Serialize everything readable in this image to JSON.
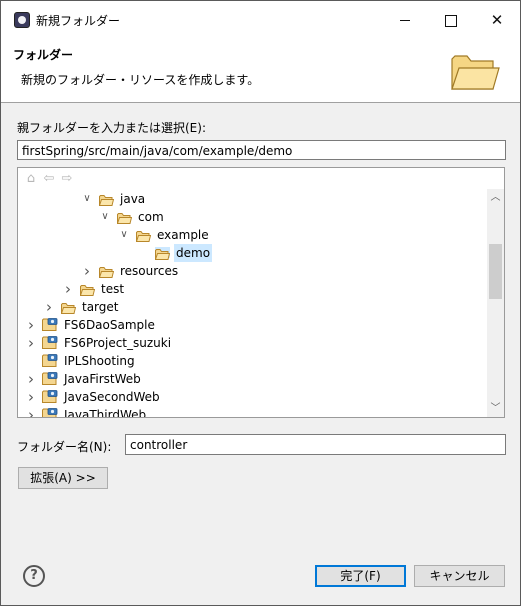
{
  "window": {
    "title": "新規フォルダー",
    "minimize": "minimize",
    "maximize": "maximize",
    "close": "✕"
  },
  "banner": {
    "title": "フォルダー",
    "description": "新規のフォルダー・リソースを作成します。",
    "icon": "folder-large-icon"
  },
  "parent": {
    "label": "親フォルダーを入力または選択(E):",
    "value": "firstSpring/src/main/java/com/example/demo"
  },
  "toolbar": {
    "home_icon": "home-icon",
    "back_icon": "back-arrow-icon",
    "forward_icon": "forward-arrow-icon"
  },
  "tree": [
    {
      "label": "java",
      "twisty": "expanded",
      "icon": "folder"
    },
    {
      "label": "com",
      "twisty": "expanded",
      "icon": "folder"
    },
    {
      "label": "example",
      "twisty": "expanded",
      "icon": "folder"
    },
    {
      "label": "demo",
      "twisty": "none",
      "icon": "folder",
      "selected": true
    },
    {
      "label": "resources",
      "twisty": "collapsed",
      "icon": "folder"
    },
    {
      "label": "test",
      "twisty": "collapsed",
      "icon": "folder"
    },
    {
      "label": "target",
      "twisty": "collapsed",
      "icon": "folder"
    },
    {
      "label": "FS6DaoSample",
      "twisty": "collapsed",
      "icon": "project"
    },
    {
      "label": "FS6Project_suzuki",
      "twisty": "collapsed",
      "icon": "project"
    },
    {
      "label": "IPLShooting",
      "twisty": "none",
      "icon": "project"
    },
    {
      "label": "JavaFirstWeb",
      "twisty": "collapsed",
      "icon": "project"
    },
    {
      "label": "JavaSecondWeb",
      "twisty": "collapsed",
      "icon": "project"
    },
    {
      "label": "JavaThirdWeb",
      "twisty": "collapsed",
      "icon": "project"
    }
  ],
  "folder_name": {
    "label": "フォルダー名(N):",
    "value": "controller"
  },
  "advanced_button": "拡張(A) >>",
  "help": "?",
  "finish_button": "完了(F)",
  "cancel_button": "キャンセル",
  "colors": {
    "selection": "#cce8ff",
    "folder": "#e8b84a",
    "default_button_border": "#0078d7"
  }
}
